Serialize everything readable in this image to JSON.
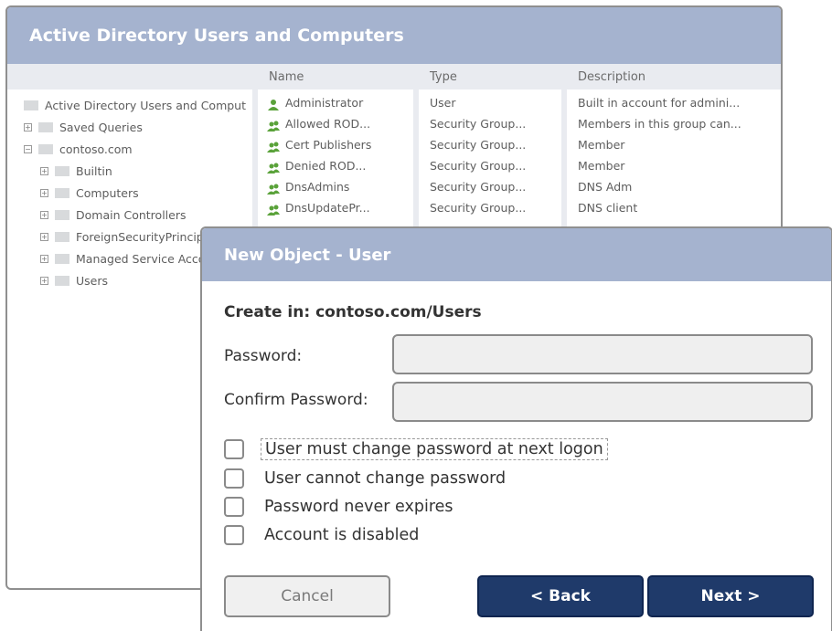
{
  "aduc": {
    "title": "Active Directory Users and Computers",
    "columns": {
      "name": "Name",
      "type": "Type",
      "description": "Description"
    },
    "tree": [
      {
        "label": "Active Directory Users and Comput"
      },
      {
        "label": "Saved Queries"
      },
      {
        "label": "contoso.com"
      },
      {
        "label": "Builtin"
      },
      {
        "label": "Computers"
      },
      {
        "label": "Domain Controllers"
      },
      {
        "label": "ForeignSecurityPrincipals"
      },
      {
        "label": "Managed Service Accounts"
      },
      {
        "label": "Users"
      }
    ],
    "rows": [
      {
        "name": "Administrator",
        "type": "User",
        "description": "Built in account for admini..."
      },
      {
        "name": "Allowed ROD...",
        "type": "Security Group...",
        "description": "Members in this group can..."
      },
      {
        "name": "Cert Publishers",
        "type": "Security Group...",
        "description": "Member"
      },
      {
        "name": "Denied ROD...",
        "type": "Security Group...",
        "description": "Member"
      },
      {
        "name": "DnsAdmins",
        "type": "Security Group...",
        "description": "DNS Adm"
      },
      {
        "name": "DnsUpdatePr...",
        "type": "Security Group...",
        "description": "DNS client"
      }
    ]
  },
  "dialog": {
    "title": "New Object - User",
    "create_in": "Create in: contoso.com/Users",
    "password_label": "Password:",
    "password_value": "",
    "confirm_label": "Confirm Password:",
    "confirm_value": "",
    "options": [
      {
        "label": "User must change password at next logon",
        "checked": false
      },
      {
        "label": "User cannot change password",
        "checked": false
      },
      {
        "label": "Password never expires",
        "checked": false
      },
      {
        "label": "Account is disabled",
        "checked": false
      }
    ],
    "buttons": {
      "cancel": "Cancel",
      "back": "< Back",
      "next": "Next >"
    }
  },
  "colors": {
    "titlebar": "#a5b3cf",
    "primary_button": "#1f3a6a",
    "user_icon_green": "#5aa23a"
  },
  "icons": {
    "user": "user-icon",
    "group": "group-icon",
    "folder": "folder-icon"
  }
}
